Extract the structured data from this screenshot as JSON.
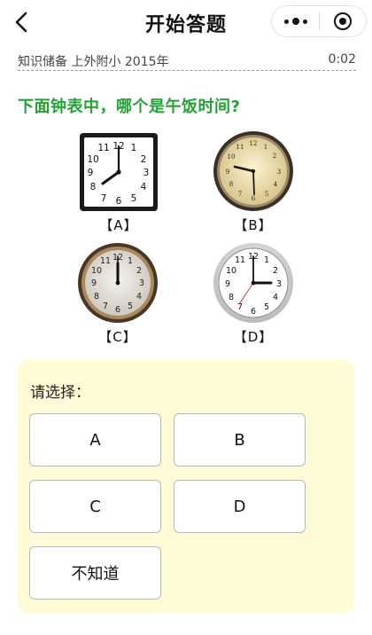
{
  "navbar": {
    "title": "开始答题",
    "back_icon": "back-arrow-icon",
    "more_icon": "more-dots-icon",
    "close_icon": "target-close-icon"
  },
  "info": {
    "text": "知识储备 上外附小 2015年",
    "timer": "0:02"
  },
  "question": {
    "text": "下面钟表中，哪个是午饭时间?"
  },
  "options": [
    {
      "label": "【A】",
      "time": "8:00",
      "style": "square-black-frame"
    },
    {
      "label": "【B】",
      "time": "9:30",
      "style": "gold-round"
    },
    {
      "label": "【C】",
      "time": "12:00",
      "style": "bronze-round"
    },
    {
      "label": "【D】",
      "time": "3:00",
      "style": "silver-round"
    }
  ],
  "choices": {
    "title": "请选择：",
    "buttons": [
      "A",
      "B",
      "C",
      "D",
      "不知道"
    ]
  },
  "colors": {
    "question_green": "#23a235",
    "panel_bg": "#fffbd6",
    "button_border": "#b9b9b9"
  }
}
